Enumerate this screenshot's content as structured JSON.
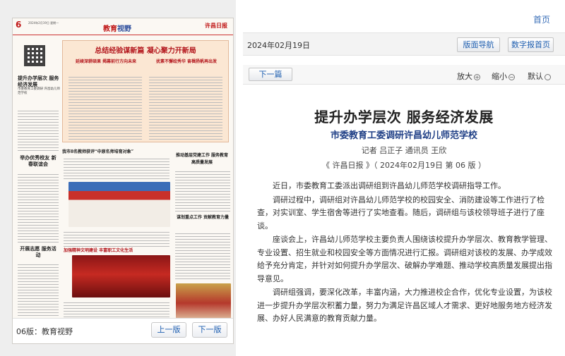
{
  "paper": {
    "page_number": "6",
    "header_date": "2024年2月19日 星期一",
    "section_name_a": "教育",
    "section_name_b": "视野",
    "masthead": "许昌日报",
    "banner_title": "总结经验谋新篇 凝心聚力开新局",
    "banner_left": "延续深耕硕果 揭幕前行方向未来",
    "banner_right": "扰素不懈绘秀华 奋楫扬帆再出发",
    "side1_title": "提升办学层次 服务经济发展",
    "side1_sub": "市委教育工委调研 许昌幼儿师范学校",
    "side2_title": "举办优秀校友 新春联谊会",
    "side3_title": "开展志愿 服务活动",
    "mid1": "我市8名教师获评“中原名师培育对象”",
    "mid2": "推动基层党建工作 服务教育高质量发展",
    "mid3": "谋划重点工作 贡献教育力量",
    "mid4": "加强精神文明建设 丰富职工文化生活",
    "footer_label": "06版：教育视野",
    "prev_label": "上一版",
    "next_label": "下一版"
  },
  "header": {
    "home_link": "首页",
    "date": "2024年02月19日",
    "nav_button": "版面导航",
    "digital_button": "数字报首页"
  },
  "toolbar": {
    "next_article": "下一篇",
    "zoom_in": "放大",
    "zoom_out": "缩小",
    "default": "默认"
  },
  "article": {
    "title": "提升办学层次 服务经济发展",
    "subtitle": "市委教育工委调研许昌幼儿师范学校",
    "authors": "记者 吕正子 通讯员 王欣",
    "source": "《 许昌日报 》（ 2024年02月19日 第 06 版 ）",
    "paragraphs": [
      "近日，市委教育工委派出调研组到许昌幼儿师范学校调研指导工作。",
      "调研过程中，调研组对许昌幼儿师范学校的校园安全、消防建设等工作进行了检查，对实训室、学生宿舍等进行了实地查看。随后，调研组与该校领导班子进行了座谈。",
      "座谈会上，许昌幼儿师范学校主要负责人围绕该校提升办学层次、教育教学管理、专业设置、招生就业和校园安全等方面情况进行汇报。调研组对该校的发展、办学成效给予充分肯定，并针对如何提升办学层次、破解办学难题、推动学校高质量发展提出指导意见。",
      "调研组强调，要深化改革，丰富内涵，大力推进校企合作，优化专业设置，为该校进一步提升办学层次积蓄力量，努力为满足许昌区域人才需求、更好地服务地方经济发展、办好人民满意的教育贡献力量。"
    ]
  },
  "colors": {
    "link_blue": "#1f5fb0",
    "subtitle_blue": "#1f3f86",
    "paper_red": "#c01818"
  }
}
